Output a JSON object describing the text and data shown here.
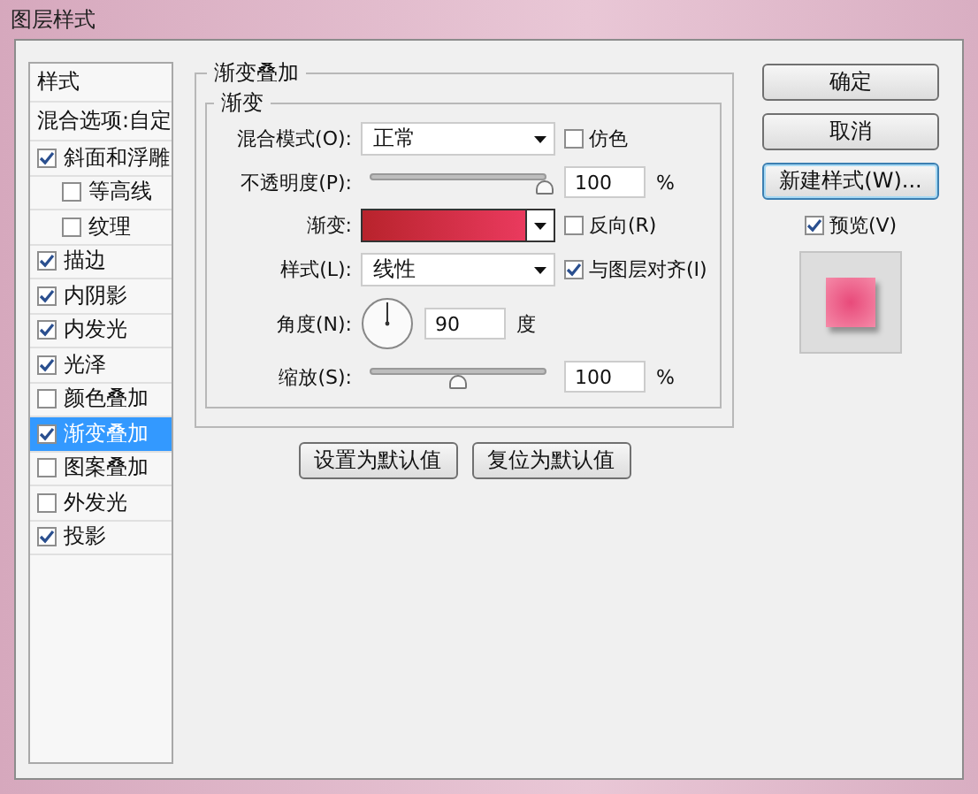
{
  "window": {
    "title": "图层样式"
  },
  "styles": [
    {
      "kind": "header",
      "label": "样式",
      "selected": false
    },
    {
      "kind": "option",
      "label": "混合选项:自定",
      "selected": false
    },
    {
      "kind": "effect",
      "label": "斜面和浮雕",
      "checked": true,
      "selected": false,
      "children": [
        {
          "kind": "effect",
          "label": "等高线",
          "checked": false,
          "selected": false
        },
        {
          "kind": "effect",
          "label": "纹理",
          "checked": false,
          "selected": false
        }
      ]
    },
    {
      "kind": "effect",
      "label": "描边",
      "checked": true,
      "selected": false
    },
    {
      "kind": "effect",
      "label": "内阴影",
      "checked": true,
      "selected": false
    },
    {
      "kind": "effect",
      "label": "内发光",
      "checked": true,
      "selected": false
    },
    {
      "kind": "effect",
      "label": "光泽",
      "checked": true,
      "selected": false
    },
    {
      "kind": "effect",
      "label": "颜色叠加",
      "checked": false,
      "selected": false
    },
    {
      "kind": "effect",
      "label": "渐变叠加",
      "checked": true,
      "selected": true
    },
    {
      "kind": "effect",
      "label": "图案叠加",
      "checked": false,
      "selected": false
    },
    {
      "kind": "effect",
      "label": "外发光",
      "checked": false,
      "selected": false
    },
    {
      "kind": "effect",
      "label": "投影",
      "checked": true,
      "selected": false
    }
  ],
  "panel": {
    "title": "渐变叠加",
    "group": "渐变",
    "blend_mode": {
      "label": "混合模式(O):",
      "value": "正常"
    },
    "dither": {
      "label": "仿色",
      "checked": false
    },
    "opacity": {
      "label": "不透明度(P):",
      "level": 1,
      "value": "100",
      "unit": "%"
    },
    "gradient": {
      "label": "渐变:"
    },
    "reverse": {
      "label": "反向(R)",
      "checked": false
    },
    "style": {
      "label": "样式(L):",
      "value": "线性"
    },
    "align": {
      "label": "与图层对齐(I)",
      "checked": true
    },
    "angle": {
      "label": "角度(N):",
      "value": "90",
      "unit": "度"
    },
    "scale": {
      "label": "缩放(S):",
      "level": 0.5,
      "value": "100",
      "unit": "%"
    },
    "buttons": [
      "设置为默认值",
      "复位为默认值"
    ]
  },
  "actions": [
    {
      "label": "确定",
      "focused": false
    },
    {
      "label": "取消",
      "focused": false
    },
    {
      "label": "新建样式(W)...",
      "focused": true
    }
  ],
  "preview": {
    "label": "预览(V)",
    "checked": true
  }
}
